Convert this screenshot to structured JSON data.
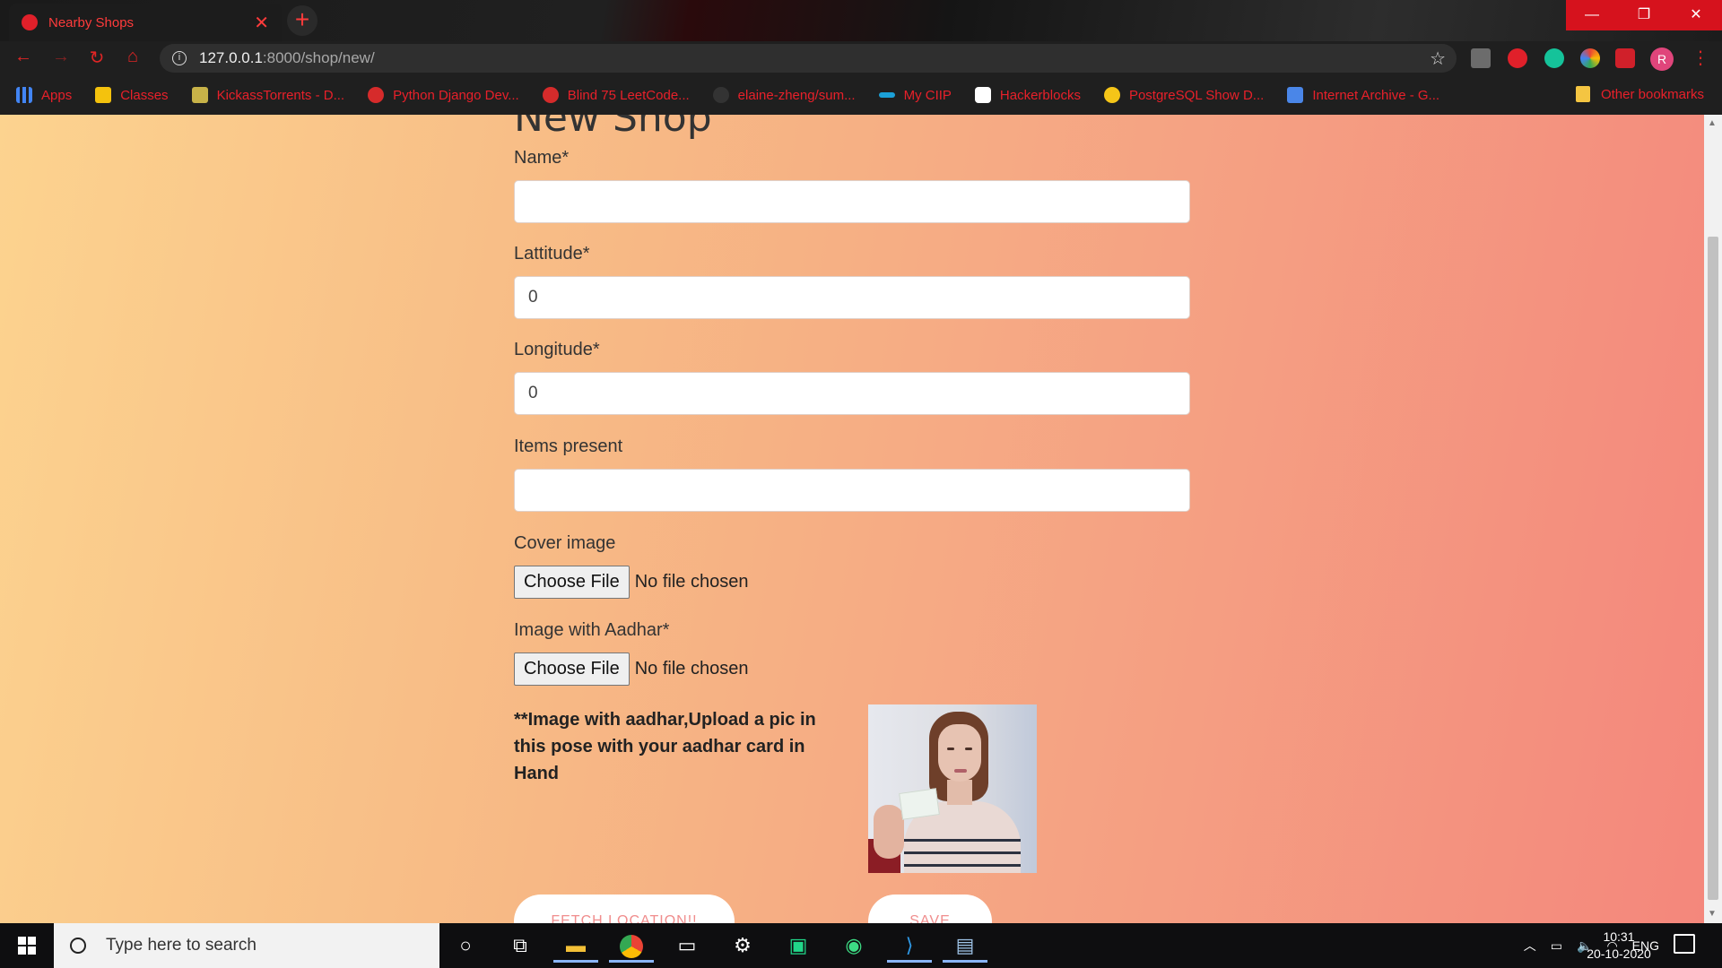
{
  "browser": {
    "tab_title": "Nearby Shops",
    "tab_close": "✕",
    "new_tab": "+",
    "window_buttons": [
      "—",
      "❐",
      "✕"
    ],
    "url_host": "127.0.0.1",
    "url_path": ":8000/shop/new/",
    "profile_initial": "R",
    "bookmarks": [
      {
        "label": "Apps",
        "icon": "apps-grid-icon",
        "color": "#4285f4"
      },
      {
        "label": "Classes",
        "icon": "classroom-icon",
        "color": "#f4c20d"
      },
      {
        "label": "KickassTorrents - D...",
        "icon": "kickass-icon",
        "color": "#c7b248"
      },
      {
        "label": "Python Django Dev...",
        "icon": "red-globe-icon",
        "color": "#d62b2b"
      },
      {
        "label": "Blind 75 LeetCode...",
        "icon": "red-globe-icon",
        "color": "#d62b2b"
      },
      {
        "label": "elaine-zheng/sum...",
        "icon": "github-icon",
        "color": "#333333"
      },
      {
        "label": "My CIIP",
        "icon": "cisco-icon",
        "color": "#1ba0d7"
      },
      {
        "label": "Hackerblocks",
        "icon": "hackerblocks-icon",
        "color": "#ffffff"
      },
      {
        "label": "PostgreSQL Show D...",
        "icon": "postgres-icon",
        "color": "#f5c518"
      },
      {
        "label": "Internet Archive - G...",
        "icon": "document-icon",
        "color": "#4a86e8"
      }
    ],
    "other_bookmarks": "Other bookmarks"
  },
  "page": {
    "title": "New Shop",
    "fields": {
      "name_label": "Name*",
      "name_value": "",
      "lat_label": "Lattitude*",
      "lat_value": "0",
      "lng_label": "Longitude*",
      "lng_value": "0",
      "items_label": "Items present",
      "items_value": "",
      "cover_label": "Cover image",
      "aadhar_label": "Image with Aadhar*"
    },
    "file_button": "Choose File",
    "file_status": "No file chosen",
    "note": "**Image with aadhar,Upload a pic in this pose with your aadhar card in Hand",
    "fetch_button": "FETCH LOCATION!!",
    "save_button": "SAVE"
  },
  "taskbar": {
    "search_placeholder": "Type here to search",
    "language": "ENG",
    "time": "10:31",
    "date": "20-10-2020"
  },
  "colors": {
    "accent_red": "#e8202a",
    "gradient_start": "#fcd38f",
    "gradient_end": "#f4877c"
  }
}
